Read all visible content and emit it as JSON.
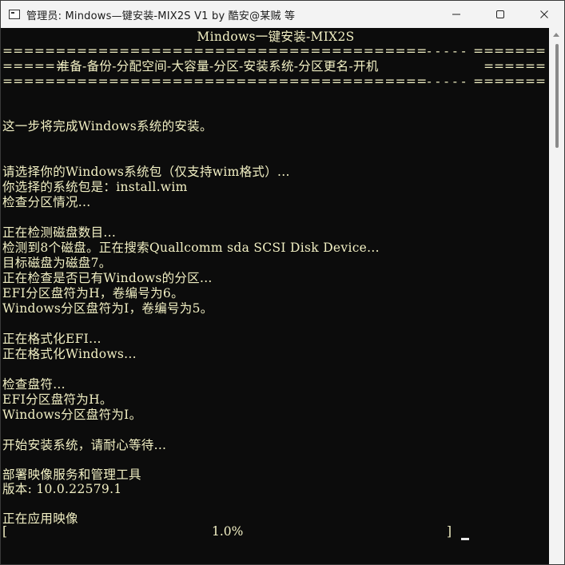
{
  "window": {
    "title": "管理员:  Mindows—键安装-MIX2S V1 by 酷安@某贼 等",
    "controls": {
      "minimize": "—",
      "maximize": "☐",
      "close": "✕"
    }
  },
  "console": {
    "header_title": "Mindows一键安装-MIX2S",
    "rule_top_left": "========================================- - - - -",
    "rule_top_right": "=======",
    "steps_left": "======",
    "steps_text": "  准备-备份-分配空间-大容量-分区-安装系统-分区更名-开机  ",
    "steps_right": "======",
    "rule_bot_left": "========================================- - - - -",
    "rule_bot_right": "=======",
    "lines": [
      "这一步将完成Windows系统的安装。",
      "请选择你的Windows系统包（仅支持wim格式）...",
      "你选择的系统包是：install.wim",
      "检查分区情况...",
      "正在检测磁盘数目...",
      "检测到8个磁盘。正在搜索Quallcomm sda SCSI Disk Device...",
      "目标磁盘为磁盘7。",
      "正在检查是否已有Windows的分区...",
      "EFI分区盘符为H，卷编号为6。",
      "Windows分区盘符为I，卷编号为5。",
      "正在格式化EFI...",
      "正在格式化Windows...",
      "检查盘符...",
      "EFI分区盘符为H。",
      "Windows分区盘符为I。",
      "开始安装系统，请耐心等待...",
      "部署映像服务和管理工具",
      "版本: 10.0.22579.1",
      "正在应用映像"
    ],
    "progress": {
      "left_bracket": "[",
      "percent": "1.0%",
      "right_bracket": "]",
      "value": 0.01
    }
  }
}
